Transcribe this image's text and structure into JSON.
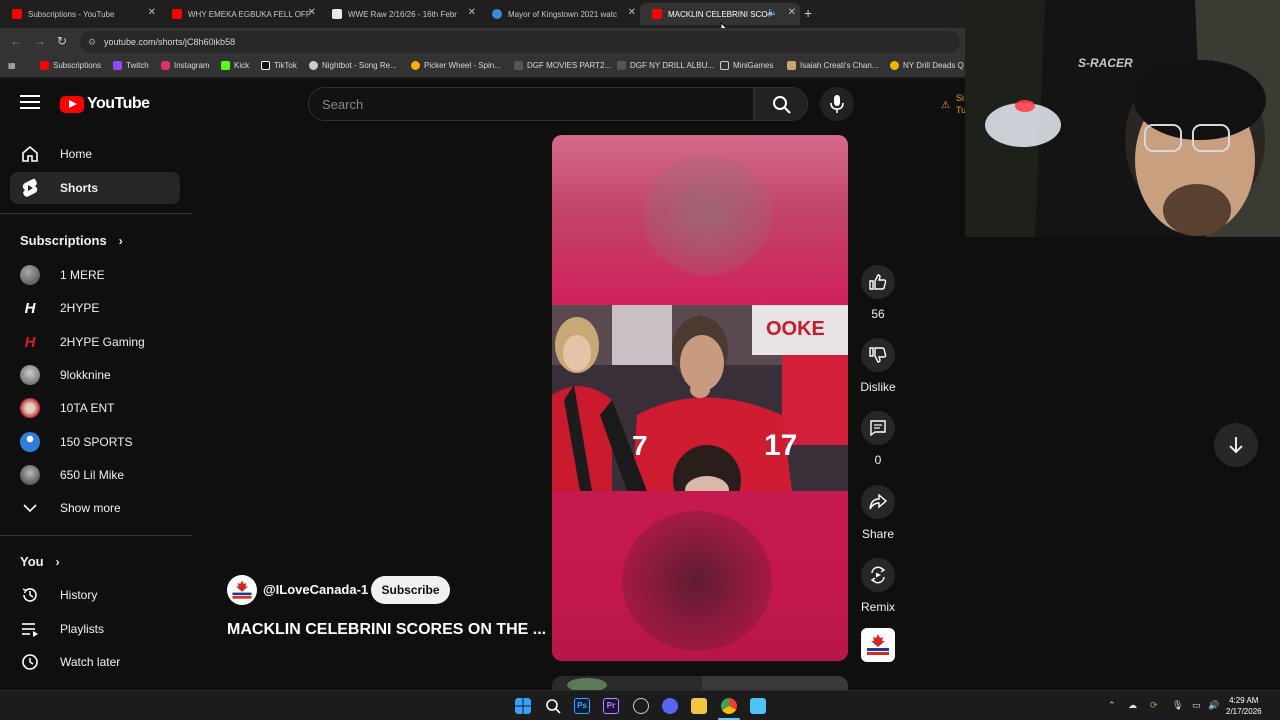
{
  "browser": {
    "tabs": [
      {
        "title": "Subscriptions - YouTube",
        "favicon_color": "#ff0000"
      },
      {
        "title": "WHY EMEKA EGBUKA FELL OFF",
        "favicon_color": "#ff0000"
      },
      {
        "title": "WWE Raw 2/16/26 - 16th Febr",
        "favicon_color": "#e8e8e8"
      },
      {
        "title": "Mayor of Kingstown 2021 watc",
        "favicon_color": "#3d8bd4"
      },
      {
        "title": "MACKLIN CELEBRINI SCOR",
        "favicon_color": "#ff0000",
        "active": true
      }
    ],
    "url": "youtube.com/shorts/jC8h60ikb58",
    "bookmarks": [
      {
        "label": "Subscriptions",
        "color": "#ff0000"
      },
      {
        "label": "Twitch",
        "color": "#9146ff"
      },
      {
        "label": "Instagram",
        "color": "#e1306c"
      },
      {
        "label": "Kick",
        "color": "#53fc18"
      },
      {
        "label": "TikTok",
        "color": "#ffffff"
      },
      {
        "label": "Nightbot - Song Re...",
        "color": "#cccccc"
      },
      {
        "label": "Picker Wheel - Spin...",
        "color": "#f4b400"
      },
      {
        "label": "DGF MOVIES PART2...",
        "color": "#888888"
      },
      {
        "label": "DGF NY DRILL ALBU...",
        "color": "#888888"
      },
      {
        "label": "MiniGames",
        "color": "#888888"
      },
      {
        "label": "Isaiah Creati's Chan...",
        "color": "#c9a66b"
      },
      {
        "label": "NY Drill Deads Q",
        "color": "#f4b400"
      }
    ]
  },
  "header": {
    "logo_text": "YouTube",
    "search_placeholder": "Search",
    "signin_fragment": "Si\nTu"
  },
  "sidebar": {
    "main": [
      {
        "label": "Home",
        "icon": "home-icon"
      },
      {
        "label": "Shorts",
        "icon": "shorts-icon",
        "active": true
      }
    ],
    "subscriptions_title": "Subscriptions",
    "subscriptions": [
      {
        "label": "1 MERE",
        "avatar_color": "#6b6b6b"
      },
      {
        "label": "2HYPE",
        "avatar_color": "#ffffff"
      },
      {
        "label": "2HYPE Gaming",
        "avatar_color": "#e0192b"
      },
      {
        "label": "9lokknine",
        "avatar_color": "#8a8a8a"
      },
      {
        "label": "10TA ENT",
        "avatar_color": "#c8262f"
      },
      {
        "label": "150 SPORTS",
        "avatar_color": "#2f7fd8"
      },
      {
        "label": "650 Lil Mike",
        "avatar_color": "#7a7a7a"
      }
    ],
    "show_more": "Show more",
    "you_title": "You",
    "you_items": [
      {
        "label": "History",
        "icon": "history-icon"
      },
      {
        "label": "Playlists",
        "icon": "playlists-icon"
      },
      {
        "label": "Watch later",
        "icon": "watch-later-icon"
      }
    ]
  },
  "short": {
    "channel": "@ILoveCanada-1",
    "subscribe": "Subscribe",
    "title": "MACKLIN CELEBRINI SCORES ON THE ...",
    "likes": "56",
    "dislike": "Dislike",
    "comments": "0",
    "share": "Share",
    "remix": "Remix",
    "channel_badge": "I LOVE CANADA"
  },
  "webcam": {
    "chair_brand": "S-RACER"
  },
  "taskbar": {
    "time": "4:29 AM",
    "date": "2/17/2026"
  }
}
